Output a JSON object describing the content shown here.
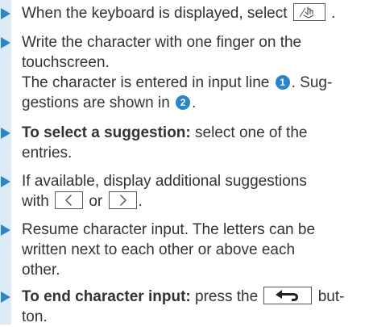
{
  "steps": [
    {
      "lines": [
        {
          "before": "When the keyboard is displayed, select",
          "icon": "hand-writing-icon",
          "after": "."
        }
      ]
    },
    {
      "lines": [
        {
          "text": "Write the character with one finger on the"
        },
        {
          "text": "touchscreen."
        },
        {
          "before": "The character is entered in input line",
          "badge": "1",
          "after": ". Sug-"
        },
        {
          "before": "gestions are shown in",
          "badge": "2",
          "after": "."
        }
      ]
    },
    {
      "lines": [
        {
          "bold": "To select a suggestion:",
          "text": " select one of the"
        },
        {
          "text": "entries."
        }
      ]
    },
    {
      "lines": [
        {
          "text": "If available, display additional suggestions"
        },
        {
          "before": "with",
          "icon1": "chevron-left-icon",
          "mid": "or",
          "icon2": "chevron-right-icon",
          "after": "."
        }
      ]
    },
    {
      "lines": [
        {
          "text": "Resume character input. The letters can be"
        },
        {
          "text": "written next to each other or above each"
        },
        {
          "text": "other."
        }
      ]
    },
    {
      "lines": [
        {
          "bold": "To end character input:",
          "before": " press the",
          "icon": "back-arrow-icon",
          "after": " but-"
        },
        {
          "text": "ton."
        }
      ]
    }
  ],
  "colors": {
    "accent": "#2a86c7",
    "sidebar": "#dbeaf5",
    "text": "#333333"
  }
}
